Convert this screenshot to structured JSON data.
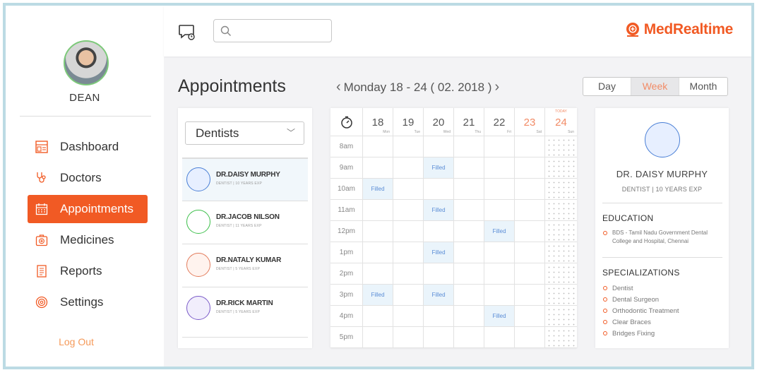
{
  "user": {
    "name": "DEAN"
  },
  "nav": {
    "items": [
      {
        "label": "Dashboard",
        "icon": "dashboard-icon"
      },
      {
        "label": "Doctors",
        "icon": "stethoscope-icon"
      },
      {
        "label": "Appointments",
        "icon": "calendar-icon",
        "active": true
      },
      {
        "label": "Medicines",
        "icon": "medicine-kit-icon"
      },
      {
        "label": "Reports",
        "icon": "report-icon"
      },
      {
        "label": "Settings",
        "icon": "settings-icon"
      }
    ],
    "logout_label": "Log Out"
  },
  "header": {
    "search_placeholder": "",
    "logo_text": "MedRealtime"
  },
  "page": {
    "title": "Appointments",
    "week_label": "Monday 18 - 24 ( 02. 2018 )",
    "views": [
      "Day",
      "Week",
      "Month"
    ],
    "selected_view": "Week"
  },
  "doctors": {
    "filter_value": "Dentists",
    "list": [
      {
        "name": "DR.DAISY MURPHY",
        "meta": "DENTIST | 10 YEARS EXP",
        "color": "#4a7fd6",
        "fill": "#e7efff",
        "selected": true
      },
      {
        "name": "DR.JACOB NILSON",
        "meta": "DENTIST | 11 YEARS EXP",
        "color": "#3cbf4a",
        "fill": "#ffffff"
      },
      {
        "name": "DR.NATALY KUMAR",
        "meta": "DENTIST | 5 YEARS EXP",
        "color": "#e27a5a",
        "fill": "#fff3ee"
      },
      {
        "name": "DR.RICK MARTIN",
        "meta": "DENTIST | 5 YEARS EXP",
        "color": "#7a5ac8",
        "fill": "#f1eefc"
      }
    ]
  },
  "calendar": {
    "days": [
      {
        "num": "18",
        "day": "Mon"
      },
      {
        "num": "19",
        "day": "Tue"
      },
      {
        "num": "20",
        "day": "Wed"
      },
      {
        "num": "21",
        "day": "Thu"
      },
      {
        "num": "22",
        "day": "Fri"
      },
      {
        "num": "23",
        "day": "Sat",
        "weekend": true
      },
      {
        "num": "24",
        "day": "Sun",
        "weekend": true,
        "today": "TODAY"
      }
    ],
    "times": [
      "8am",
      "9am",
      "10am",
      "11am",
      "12pm",
      "1pm",
      "2pm",
      "3pm",
      "4pm",
      "5pm"
    ],
    "filled_label": "Filled",
    "filled_slots": [
      {
        "time": 1,
        "day": 2
      },
      {
        "time": 2,
        "day": 0
      },
      {
        "time": 3,
        "day": 2
      },
      {
        "time": 4,
        "day": 4
      },
      {
        "time": 5,
        "day": 2
      },
      {
        "time": 7,
        "day": 0
      },
      {
        "time": 7,
        "day": 2
      },
      {
        "time": 8,
        "day": 4
      }
    ]
  },
  "detail": {
    "name": "DR. DAISY MURPHY",
    "subtitle": "DENTIST | 10 YEARS EXP",
    "education_title": "EDUCATION",
    "education": [
      "BDS - Tamil Nadu  Government Dental College and Hospital, Chennai"
    ],
    "specializations_title": "SPECIALIZATIONS",
    "specializations": [
      "Dentist",
      "Dental Surgeon",
      "Orthodontic Treatment",
      "Clear Braces",
      "Bridges Fixing"
    ]
  }
}
